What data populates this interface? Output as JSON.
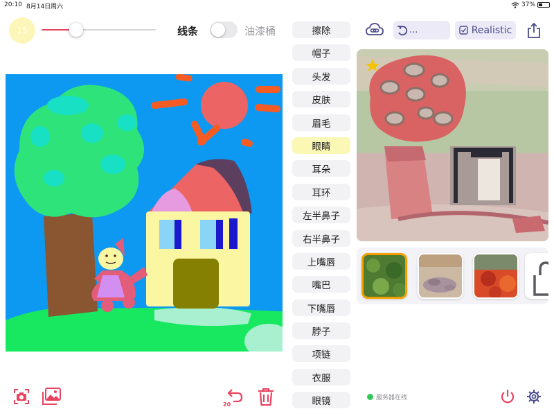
{
  "status_bar": {
    "time": "20:10",
    "date": "8月14日周六",
    "battery": "37%",
    "battery_level": 0.37
  },
  "brush": {
    "size": "15",
    "size_fraction": 0.3
  },
  "mode": {
    "left_label": "线条",
    "right_label": "油漆桶",
    "toggle_on": false
  },
  "labels": {
    "items": [
      "擦除",
      "帽子",
      "头发",
      "皮肤",
      "眉毛",
      "眼睛",
      "耳朵",
      "耳环",
      "左半鼻子",
      "右半鼻子",
      "上嘴唇",
      "嘴巴",
      "下嘴唇",
      "脖子",
      "项链",
      "衣服",
      "眼镜"
    ],
    "selected_index": 5
  },
  "toolbar": {
    "sync_label": "...",
    "style_label": "Realistic"
  },
  "style_thumbnails": [
    "grass-texture",
    "rocky-sand-texture",
    "autumn-leaves-texture",
    "more-styles"
  ],
  "footer": {
    "server_status": "服务器在线",
    "undo_count": "20"
  },
  "colors": {
    "accent": "#e8435f",
    "toolbar_indigo": "#4a4a8a",
    "selected_label": "#fbf7b4",
    "online": "#34c759",
    "thumb_selected": "#f5a000"
  }
}
